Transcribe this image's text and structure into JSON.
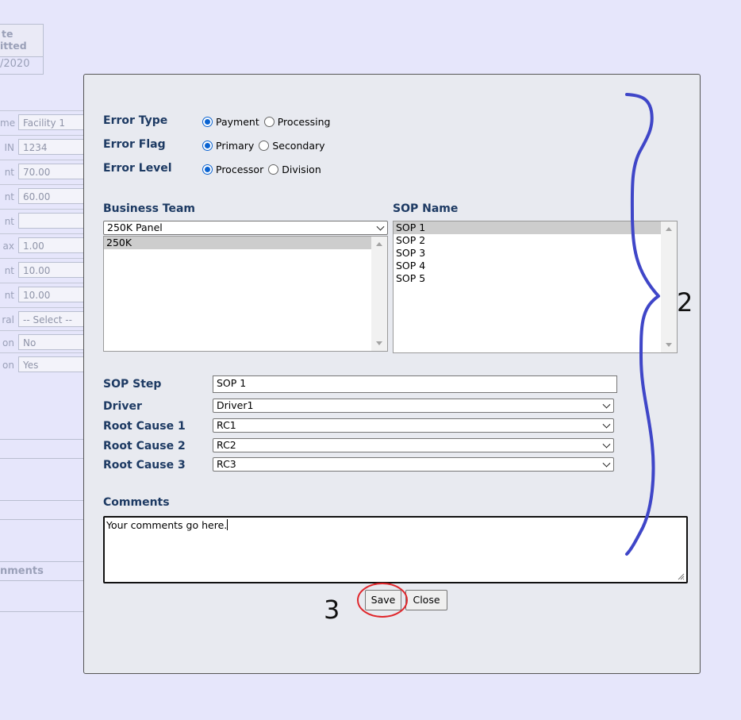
{
  "background": {
    "header_line1": "te",
    "header_line2": "itted",
    "header_value": "/2020",
    "rows": [
      {
        "label": "me",
        "value": "Facility 1"
      },
      {
        "label": "IN",
        "value": "1234"
      },
      {
        "label": "nt",
        "value": "70.00"
      },
      {
        "label": "nt",
        "value": "60.00"
      },
      {
        "label": "nt",
        "value": ""
      },
      {
        "label": "ax",
        "value": "1.00"
      },
      {
        "label": "nt",
        "value": "10.00"
      },
      {
        "label": "nt",
        "value": "10.00"
      },
      {
        "label": "ral",
        "value": "-- Select --"
      },
      {
        "label": "on",
        "value": "No"
      },
      {
        "label": "on",
        "value": "Yes"
      }
    ],
    "comments_label": "nments"
  },
  "modal": {
    "error_type": {
      "label": "Error Type",
      "options": [
        "Payment",
        "Processing"
      ],
      "selected": "Payment"
    },
    "error_flag": {
      "label": "Error Flag",
      "options": [
        "Primary",
        "Secondary"
      ],
      "selected": "Primary"
    },
    "error_level": {
      "label": "Error Level",
      "options": [
        "Processor",
        "Division"
      ],
      "selected": "Processor"
    },
    "business_team": {
      "label": "Business Team",
      "selected": "250K Panel",
      "list_items": [
        "250K"
      ]
    },
    "sop_name": {
      "label": "SOP Name",
      "items": [
        "SOP 1",
        "SOP 2",
        "SOP 3",
        "SOP 4",
        "SOP 5"
      ],
      "selected": "SOP 1"
    },
    "sop_step": {
      "label": "SOP Step",
      "value": "SOP 1"
    },
    "driver": {
      "label": "Driver",
      "value": "Driver1"
    },
    "root_cause_1": {
      "label": "Root Cause 1",
      "value": "RC1"
    },
    "root_cause_2": {
      "label": "Root Cause 2",
      "value": "RC2"
    },
    "root_cause_3": {
      "label": "Root Cause 3",
      "value": "RC3"
    },
    "comments": {
      "label": "Comments",
      "value": "Your comments go here."
    },
    "buttons": {
      "save": "Save",
      "close": "Close"
    }
  },
  "annotations": {
    "bracket_label": "2",
    "save_label": "3",
    "bracket_color": "#3f46c8",
    "circle_color": "#e0262b"
  }
}
